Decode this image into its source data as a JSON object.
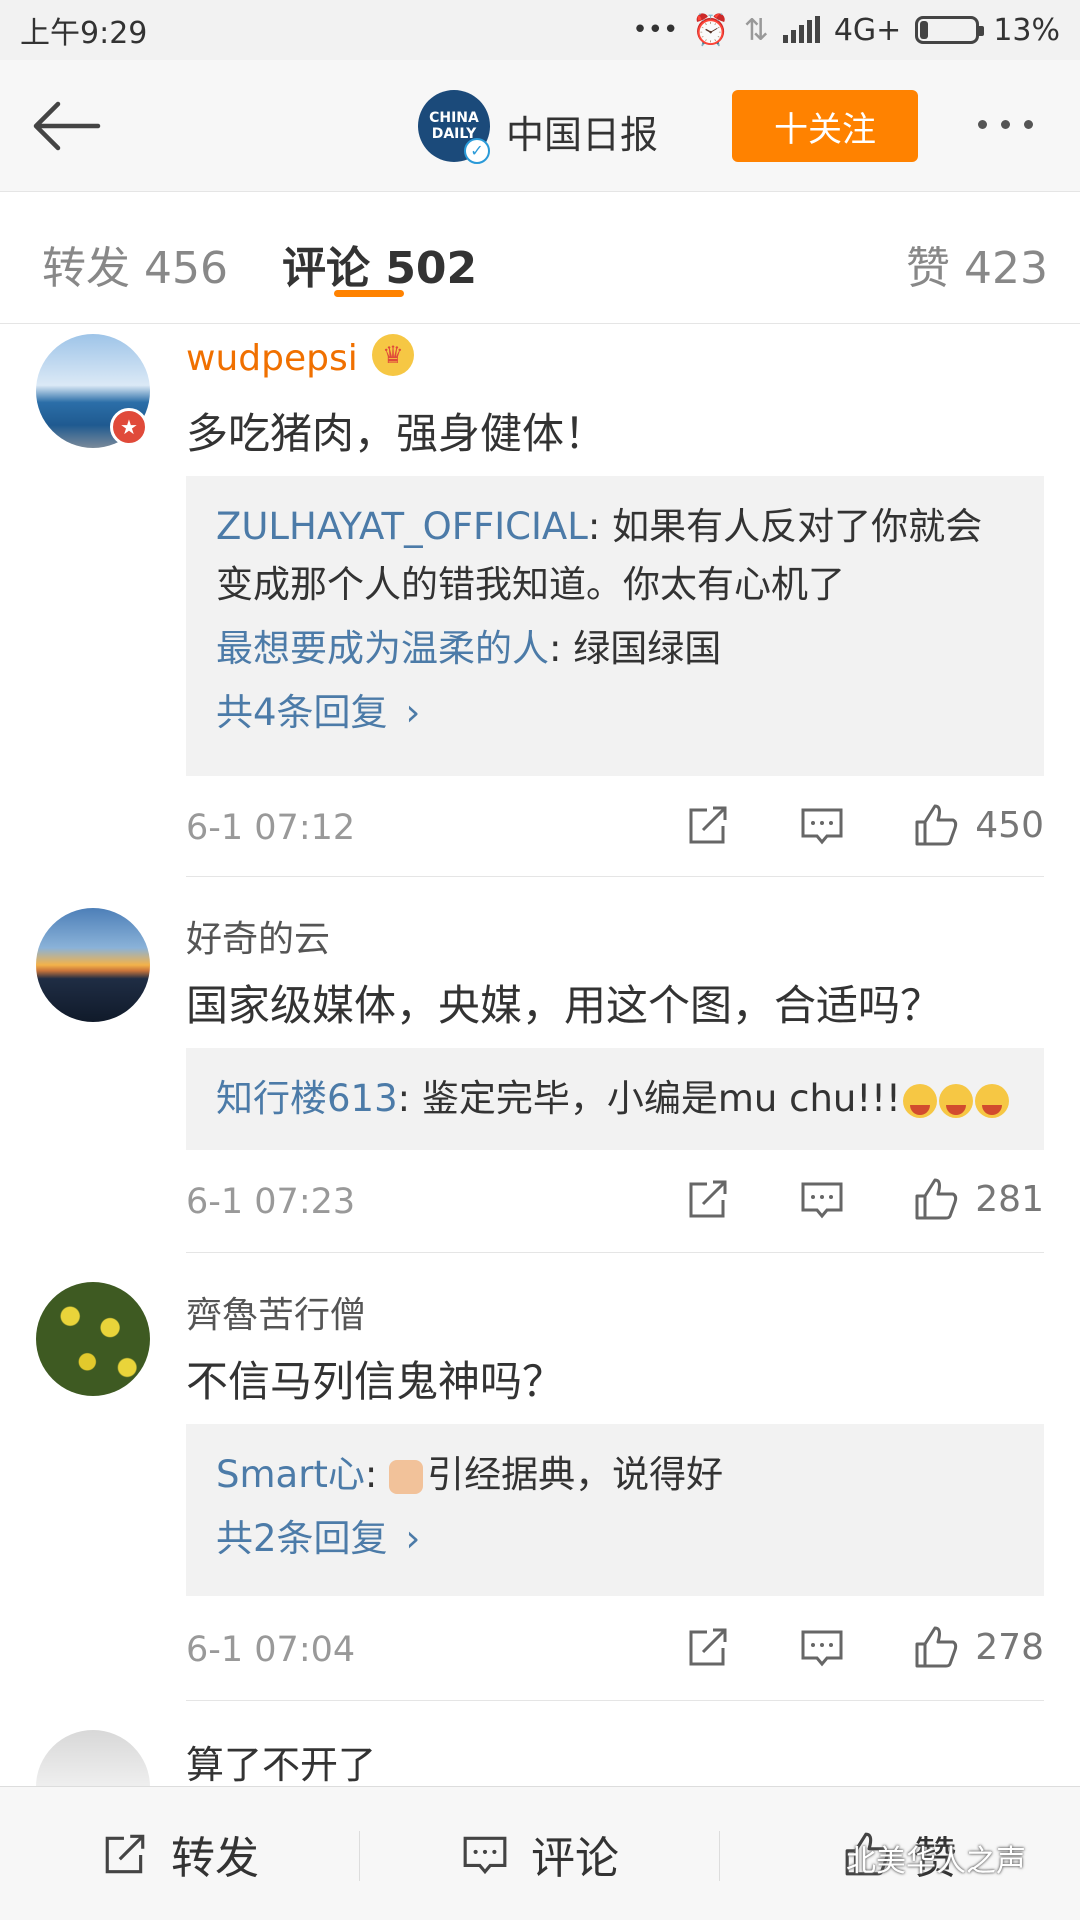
{
  "status": {
    "time": "上午9:29",
    "network": "4G+",
    "battery": "13%",
    "battery_level": 0.13
  },
  "nav": {
    "title": "中国日报",
    "logo_text": "CHINA DAILY",
    "follow_label": "十关注"
  },
  "tabs": {
    "repost": "转发 456",
    "comments": "评论 502",
    "likes": "赞 423"
  },
  "comments": [
    {
      "user": "wudpepsi",
      "text": "多吃猪肉，强身健体！",
      "replies": [
        {
          "name": "ZULHAYAT_OFFICIAL",
          "text": ": 如果有人反对了你就会变成那个人的错我知道。你太有心机了"
        },
        {
          "name": "最想要成为温柔的人",
          "text": ": 绿国绿国"
        }
      ],
      "more_replies": "共4条回复",
      "time": "6-1 07:12",
      "likes": "450"
    },
    {
      "user": "好奇的云",
      "text": "国家级媒体，央媒，用这个图，合适吗？",
      "replies": [
        {
          "name": "知行楼613",
          "text": ": 鉴定完毕，小编是mu chu!!!"
        }
      ],
      "time": "6-1 07:23",
      "likes": "281"
    },
    {
      "user": "齊魯苦行僧",
      "text": "不信马列信鬼神吗？",
      "replies": [
        {
          "name": "Smart心",
          "text": "引经据典，说得好"
        }
      ],
      "more_replies": "共2条回复",
      "time": "6-1 07:04",
      "likes": "278"
    },
    {
      "user": "算了不开了"
    }
  ],
  "bottom": {
    "repost": "转发",
    "comment": "评论",
    "like": "赞"
  },
  "watermark": "北美华人之声",
  "colors": {
    "accent": "#ff8200",
    "link": "#4c7ba8",
    "vip_name": "#f07000"
  }
}
